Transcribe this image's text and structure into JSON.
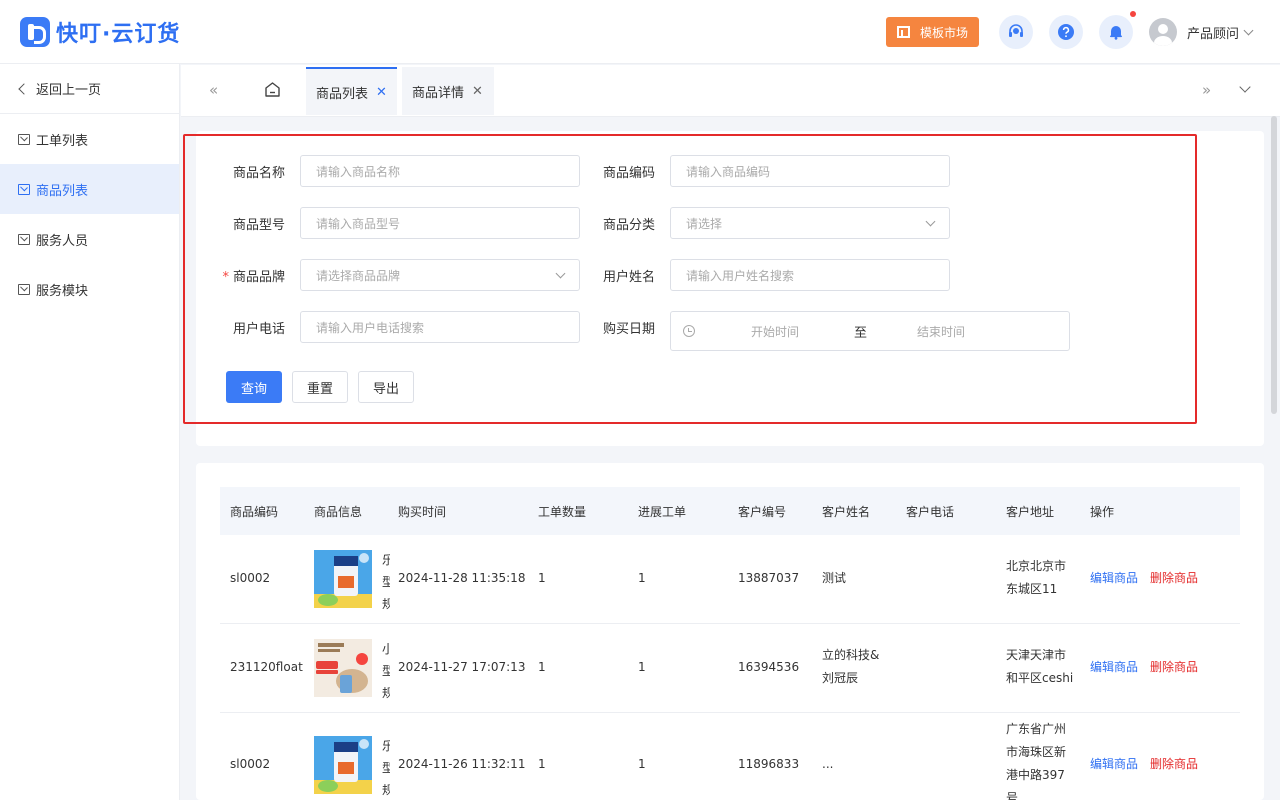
{
  "app": {
    "brand": "快叮·云订货"
  },
  "header": {
    "market_label": "模板市场",
    "user_name": "产品顾问",
    "icons": [
      "service-icon",
      "help-icon",
      "bell-icon"
    ]
  },
  "sidebar": {
    "back_label": "返回上一页",
    "items": [
      {
        "label": "工单列表",
        "active": false
      },
      {
        "label": "商品列表",
        "active": true
      },
      {
        "label": "服务人员",
        "active": false
      },
      {
        "label": "服务模块",
        "active": false
      }
    ]
  },
  "tabs": [
    {
      "label": "商品列表",
      "active": true
    },
    {
      "label": "商品详情",
      "active": false
    }
  ],
  "filters": {
    "name_label": "商品名称",
    "name_placeholder": "请输入商品名称",
    "code_label": "商品编码",
    "code_placeholder": "请输入商品编码",
    "model_label": "商品型号",
    "model_placeholder": "请输入商品型号",
    "category_label": "商品分类",
    "category_placeholder": "请选择",
    "brand_label": "商品品牌",
    "brand_required": "*",
    "brand_placeholder": "请选择商品品牌",
    "username_label": "用户姓名",
    "username_placeholder": "请输入用户姓名搜索",
    "phone_label": "用户电话",
    "phone_placeholder": "请输入用户电话搜索",
    "date_label": "购买日期",
    "date_start": "开始时间",
    "date_sep": "至",
    "date_end": "结束时间",
    "btn_query": "查询",
    "btn_reset": "重置",
    "btn_export": "导出"
  },
  "table": {
    "columns": [
      "商品编码",
      "商品信息",
      "购买时间",
      "工单数量",
      "进展工单",
      "客户编号",
      "客户姓名",
      "客户电话",
      "客户地址",
      "操作"
    ],
    "rows": [
      {
        "code": "sl0002",
        "info_cut": [
          "乐",
          "型",
          "规"
        ],
        "time": "2024-11-28 11:35:18",
        "tickets": "1",
        "progress": "1",
        "cust_no": "13887037",
        "cust_name": [
          "测试"
        ],
        "phone": "",
        "address": [
          "北京北京市",
          "东城区11"
        ],
        "edit": "编辑商品",
        "del": "删除商品"
      },
      {
        "code": "231120float",
        "info_cut": [
          "小",
          "型",
          "规"
        ],
        "time": "2024-11-27 17:07:13",
        "tickets": "1",
        "progress": "1",
        "cust_no": "16394536",
        "cust_name": [
          "立的科技&",
          "刘冠辰"
        ],
        "phone": "",
        "address": [
          "天津天津市",
          "和平区ceshi"
        ],
        "edit": "编辑商品",
        "del": "删除商品"
      },
      {
        "code": "sl0002",
        "info_cut": [
          "乐",
          "型",
          "规"
        ],
        "time": "2024-11-26 11:32:11",
        "tickets": "1",
        "progress": "1",
        "cust_no": "11896833",
        "cust_name": [
          "..."
        ],
        "phone": "",
        "address": [
          "广东省广州",
          "市海珠区新",
          "港中路397",
          "号"
        ],
        "edit": "编辑商品",
        "del": "删除商品"
      }
    ]
  },
  "colors": {
    "primary": "#3b7bf6",
    "danger": "#e42a2a",
    "orange": "#f5853f",
    "highlight": "#e42a2a"
  }
}
